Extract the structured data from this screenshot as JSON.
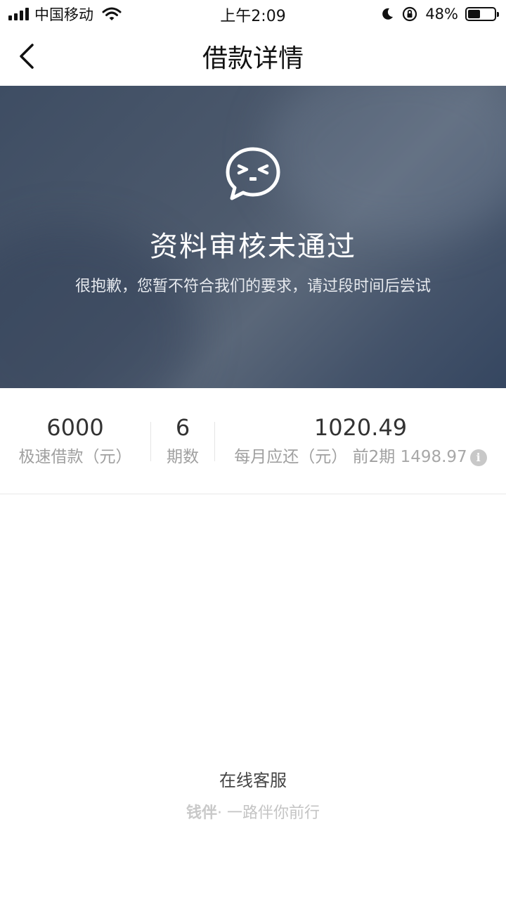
{
  "status_bar": {
    "carrier": "中国移动",
    "time": "上午2:09",
    "battery": "48%",
    "battery_level": 0.48
  },
  "nav": {
    "title": "借款详情"
  },
  "hero": {
    "title": "资料审核未通过",
    "description": "很抱歉，您暂不符合我们的要求，请过段时间后尝试"
  },
  "summary": {
    "amount": {
      "value": "6000",
      "label": "极速借款（元）"
    },
    "periods": {
      "value": "6",
      "label": "期数"
    },
    "monthly": {
      "value": "1020.49",
      "label": "每月应还（元）",
      "prev_label": "前2期",
      "prev_amount": "1498.97"
    }
  },
  "footer": {
    "service": "在线客服",
    "brand": "钱伴",
    "slogan": "· 一路伴你前行"
  },
  "colors": {
    "hero_bg": "#4a586c",
    "text_primary": "#333333",
    "text_muted": "#a0a0a0"
  }
}
